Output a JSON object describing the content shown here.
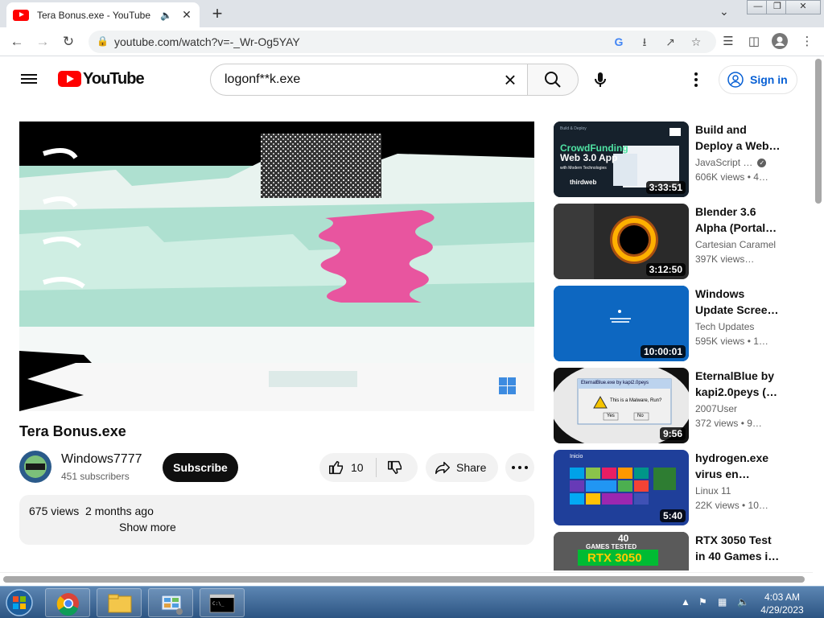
{
  "browser": {
    "tab_title": "Tera Bonus.exe - YouTube",
    "tab_audio_icon": "speaker-icon",
    "url": "youtube.com/watch?v=-_Wr-Og5YAY"
  },
  "youtube": {
    "logo_text": "YouTube",
    "search_value": "logonf**k.exe",
    "signin_label": "Sign in",
    "brand_red": "#ff0000"
  },
  "video": {
    "title": "Tera Bonus.exe",
    "channel": "Windows7777",
    "subscribers": "451 subscribers",
    "subscribe_label": "Subscribe",
    "likes": "10",
    "share_label": "Share",
    "views": "675 views",
    "age": "2 months ago",
    "show_more": "Show more"
  },
  "recommendations": [
    {
      "title": "Build and Deploy a Web…",
      "channel": "JavaScript …",
      "stats": "606K views • 4…",
      "duration": "3:33:51",
      "verified": true,
      "thumb_text": {
        "tag": "Build & Deploy",
        "line1": "CrowdFunding",
        "line2": "Web 3.0 App",
        "line3": "with Modern Technologies",
        "brand": "thirdweb"
      }
    },
    {
      "title": "Blender 3.6 Alpha (Portal…",
      "channel": "Cartesian Caramel",
      "stats": "397K views…",
      "duration": "3:12:50"
    },
    {
      "title": "Windows Update Scree…",
      "channel": "Tech Updates",
      "stats": "595K views • 1…",
      "duration": "10:00:01"
    },
    {
      "title": "EternalBlue by kapi2.0peys (…",
      "channel": "2007User",
      "stats": "372 views • 9…",
      "duration": "9:56",
      "thumb_text": {
        "dialog_title": "EternalBlue.exe by kapi2.0peys",
        "message": "This is a Malware, Run?",
        "yes": "Yes",
        "no": "No"
      }
    },
    {
      "title": "hydrogen.exe virus en…",
      "channel": "Linux 11",
      "stats": "22K views • 10…",
      "duration": "5:40",
      "thumb_text": {
        "label": "Inicio"
      }
    },
    {
      "title": "RTX 3050 Test in 40 Games i…",
      "channel": "",
      "stats": "",
      "duration": "",
      "thumb_text": {
        "top": "40",
        "mid": "GAMES TESTED",
        "big": "RTX 3050"
      }
    }
  ],
  "taskbar": {
    "time": "4:03 AM",
    "date": "4/29/2023"
  }
}
